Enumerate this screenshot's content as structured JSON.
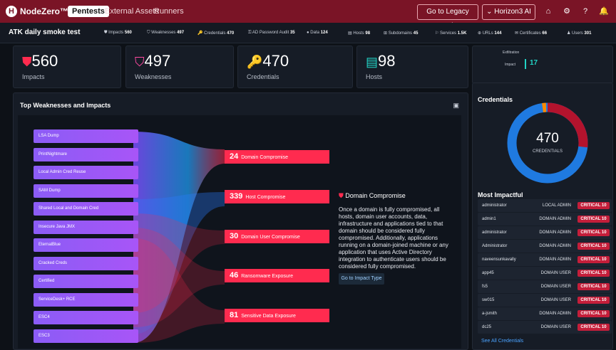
{
  "topbar": {
    "brand": "NodeZero™",
    "tabs": [
      "Pentests",
      "External Assets",
      "Runners"
    ],
    "legacy_label": "Go to Legacy Portal",
    "tenant": "Horizon3 AI Inc"
  },
  "subbar": {
    "title": "ATK daily smoke test",
    "stats": [
      {
        "label": "Impacts",
        "value": "560"
      },
      {
        "label": "Weaknesses",
        "value": "497"
      },
      {
        "label": "Credentials",
        "value": "470"
      },
      {
        "label": "AD Password Audit",
        "value": "35"
      },
      {
        "label": "Data",
        "value": "124"
      },
      {
        "label": "Hosts",
        "value": "98"
      },
      {
        "label": "Subdomains",
        "value": "45"
      },
      {
        "label": "Services",
        "value": "1.5K"
      },
      {
        "label": "URLs",
        "value": "144"
      },
      {
        "label": "Certificates",
        "value": "66"
      },
      {
        "label": "Users",
        "value": "301"
      }
    ]
  },
  "kpis": [
    {
      "value": "560",
      "label": "Impacts"
    },
    {
      "value": "497",
      "label": "Weaknesses"
    },
    {
      "value": "470",
      "label": "Credentials"
    },
    {
      "value": "98",
      "label": "Hosts"
    }
  ],
  "exfil": {
    "title": "Exfiltration",
    "impact_label": "Impact",
    "impact_value": "17"
  },
  "weaknesses_panel": {
    "title": "Top Weaknesses and Impacts",
    "weaknesses": [
      "LSA Dump",
      "PrintNightmare",
      "Local Admin Cred Reuse",
      "SAM Dump",
      "Shared Local and Domain Cred",
      "Insecure Java JMX",
      "EternalBlue",
      "Cracked Creds",
      "Certified",
      "ServiceDesk+ RCE",
      "ESC4",
      "ESC3"
    ],
    "impacts": [
      {
        "count": "24",
        "label": "Domain Compromise"
      },
      {
        "count": "339",
        "label": "Host Compromise"
      },
      {
        "count": "30",
        "label": "Domain User Compromise"
      },
      {
        "count": "46",
        "label": "Ransomware Exposure"
      },
      {
        "count": "81",
        "label": "Sensitive Data Exposure"
      }
    ],
    "detail_title": "Domain Compromise",
    "detail_text": "Once a domain is fully compromised, all hosts, domain user accounts, data, infrastructure and applications tied to that domain should be considered fully compromised. Additionally, applications running on a domain-joined machine or any application that uses Active Directory integration to authenticate users should be considered fully compromised.",
    "detail_link": "Go to Impact Type"
  },
  "credentials_panel": {
    "title": "Credentials",
    "total": "470",
    "total_label": "CREDENTIALS",
    "most_impactful": "Most Impactful",
    "rows": [
      {
        "user": "administrator",
        "role": "LOCAL ADMIN",
        "sev": "CRITICAL 10"
      },
      {
        "user": "admin1",
        "role": "DOMAIN ADMIN",
        "sev": "CRITICAL 10"
      },
      {
        "user": "administrator",
        "role": "DOMAIN ADMIN",
        "sev": "CRITICAL 10"
      },
      {
        "user": "Administrator",
        "role": "DOMAIN ADMIN",
        "sev": "CRITICAL 10"
      },
      {
        "user": "naveensunkavally",
        "role": "DOMAIN ADMIN",
        "sev": "CRITICAL 10"
      },
      {
        "user": "app45",
        "role": "DOMAIN USER",
        "sev": "CRITICAL 10"
      },
      {
        "user": "fs5",
        "role": "DOMAIN USER",
        "sev": "CRITICAL 10"
      },
      {
        "user": "sw015",
        "role": "DOMAIN USER",
        "sev": "CRITICAL 10"
      },
      {
        "user": "a-jsmith",
        "role": "DOMAIN ADMIN",
        "sev": "CRITICAL 10"
      },
      {
        "user": "dc25",
        "role": "DOMAIN USER",
        "sev": "CRITICAL 10"
      }
    ],
    "see_all": "See All Credentials",
    "colors": {
      "blue": "#1f7ae0",
      "red": "#b3132d",
      "orange": "#ff8a00"
    }
  }
}
